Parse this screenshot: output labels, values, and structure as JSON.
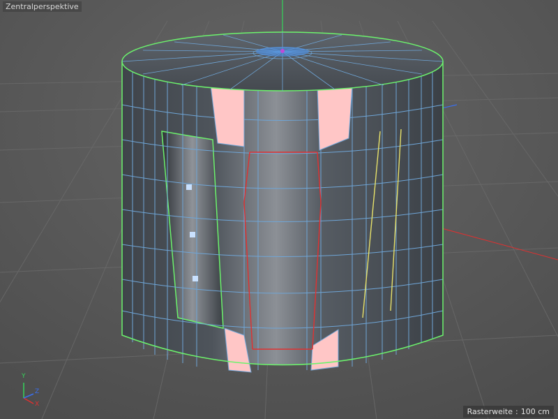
{
  "viewport": {
    "name": "Zentralperspektive",
    "grid_label": "Rasterweite",
    "grid_separator": ":",
    "grid_value": "100 cm"
  },
  "axes": {
    "x": "X",
    "y": "Y",
    "z": "Z"
  },
  "colors": {
    "background": "#5a5a5a",
    "grid_line": "#6a6a6a",
    "mesh_fill": "#555b63",
    "mesh_edge": "#6fa6d8",
    "selected_boundary": "#6cf36c",
    "selected_polygon": "#ffc6c6",
    "selected_edge_red": "#e23030",
    "selected_edge_yellow": "#e8e26a",
    "selected_point": "#c9e1ff",
    "axis_x": "#e03030",
    "axis_y": "#35d45a",
    "axis_z": "#3a6ff0"
  },
  "icons": [
    "world-axis-gizmo",
    "selected-point",
    "world-origin-axes"
  ]
}
